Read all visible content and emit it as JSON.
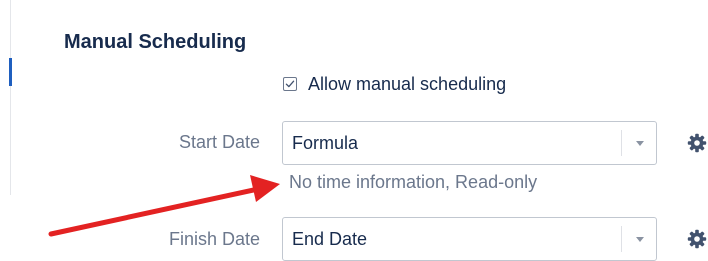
{
  "section": {
    "title": "Manual Scheduling"
  },
  "manual_scheduling": {
    "checkbox_label": "Allow manual scheduling",
    "checked": true
  },
  "start_date": {
    "label": "Start Date",
    "selected": "Formula",
    "hint": "No time information, Read-only"
  },
  "finish_date": {
    "label": "Finish Date",
    "selected": "End Date"
  },
  "icons": {
    "checkmark": "checkmark-icon",
    "dropdown": "chevron-down-icon",
    "settings": "gear-icon",
    "annotation": "red-arrow"
  },
  "colors": {
    "accent": "#1f5fbf",
    "arrow": "#e32222",
    "text_dark": "#172b4d",
    "text_muted": "#6b778c"
  }
}
